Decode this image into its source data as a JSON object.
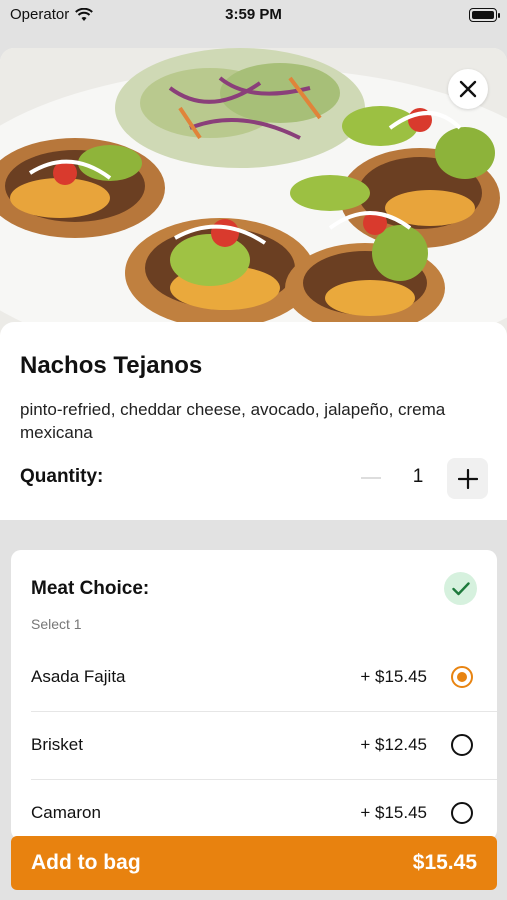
{
  "status_bar": {
    "carrier": "Operator",
    "time": "3:59 PM"
  },
  "item": {
    "title": "Nachos Tejanos",
    "description": "pinto-refried, cheddar cheese, avocado, jalapeño, crema mexicana",
    "quantity_label": "Quantity:",
    "quantity": "1"
  },
  "meat_choice": {
    "title": "Meat Choice:",
    "subtitle": "Select 1",
    "options": [
      {
        "name": "Asada Fajita",
        "price": "+ $15.45",
        "selected": true
      },
      {
        "name": "Brisket",
        "price": "+ $12.45",
        "selected": false
      },
      {
        "name": "Camaron",
        "price": "+ $15.45",
        "selected": false
      }
    ]
  },
  "footer": {
    "button_label": "Add to bag",
    "total": "$15.45"
  },
  "colors": {
    "accent": "#e8820f",
    "check_bg": "#d6f1de",
    "check_color": "#1e7a3c"
  },
  "icons": [
    "wifi-icon",
    "battery-icon",
    "close-icon",
    "minus-icon",
    "plus-icon",
    "checkmark-icon",
    "radio-icon"
  ]
}
